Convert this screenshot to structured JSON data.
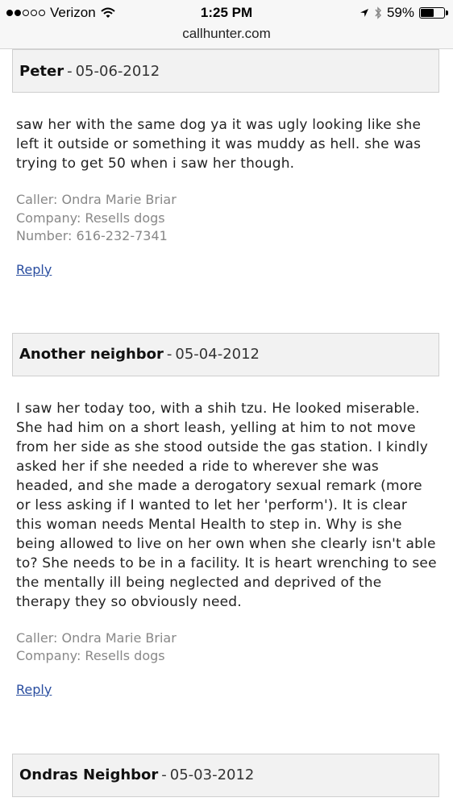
{
  "status_bar": {
    "carrier": "Verizon",
    "time": "1:25 PM",
    "battery_label": "59%",
    "battery_level": 0.59
  },
  "url_bar": {
    "domain": "callhunter.com"
  },
  "comments": [
    {
      "author": "Peter",
      "date": "05-06-2012",
      "body": "saw her with the same dog ya it was ugly looking like she left it outside or something it was muddy as hell. she was trying to get 50 when i saw her though.",
      "caller": "Caller: Ondra Marie Briar",
      "company": "Company: Resells dogs",
      "number": "Number: 616-232-7341",
      "reply": "Reply"
    },
    {
      "author": "Another neighbor",
      "date": "05-04-2012",
      "body": "I saw her today too, with a shih tzu. He looked miserable. She had him on a short leash, yelling at him to not move from her side as she stood outside the gas station. I kindly asked her if she needed a ride to wherever she was headed, and she made a derogatory sexual remark (more or less asking if I wanted to let her 'perform'). It is clear this woman needs Mental Health to step in. Why is she being allowed to live on her own when she clearly isn't able to? She needs to be in a facility. It is heart wrenching to see the mentally ill being neglected and deprived of the therapy they so obviously need.",
      "caller": "Caller: Ondra Marie Briar",
      "company": "Company: Resells dogs",
      "reply": "Reply"
    },
    {
      "author": "Ondras Neighbor",
      "date": "05-03-2012"
    }
  ],
  "separator": "-"
}
